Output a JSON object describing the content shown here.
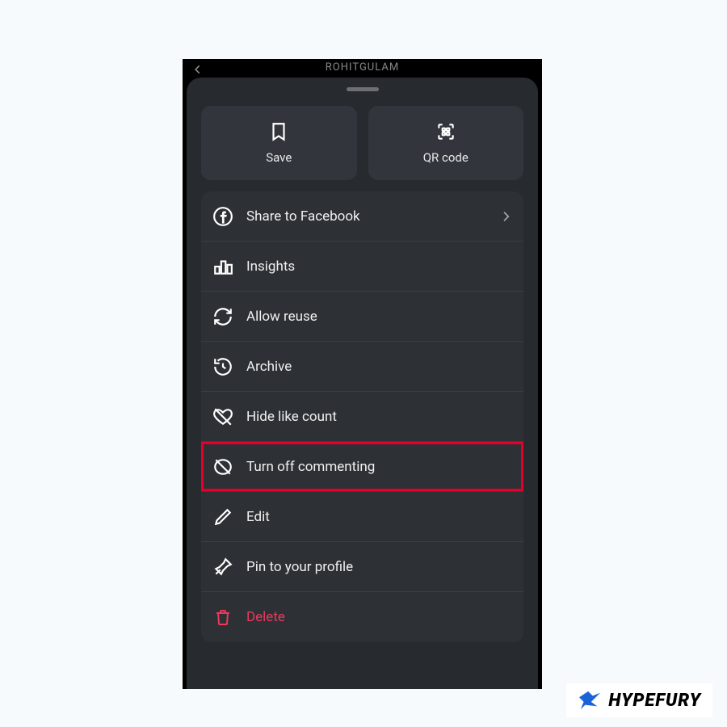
{
  "header": {
    "username": "ROHITGULAM"
  },
  "topButtons": {
    "save": "Save",
    "qr": "QR code"
  },
  "menu": {
    "shareFacebook": "Share to Facebook",
    "insights": "Insights",
    "allowReuse": "Allow reuse",
    "archive": "Archive",
    "hideLikeCount": "Hide like count",
    "turnOffCommenting": "Turn off commenting",
    "edit": "Edit",
    "pinProfile": "Pin to your profile",
    "delete": "Delete"
  },
  "watermark": "HYPEFURY"
}
